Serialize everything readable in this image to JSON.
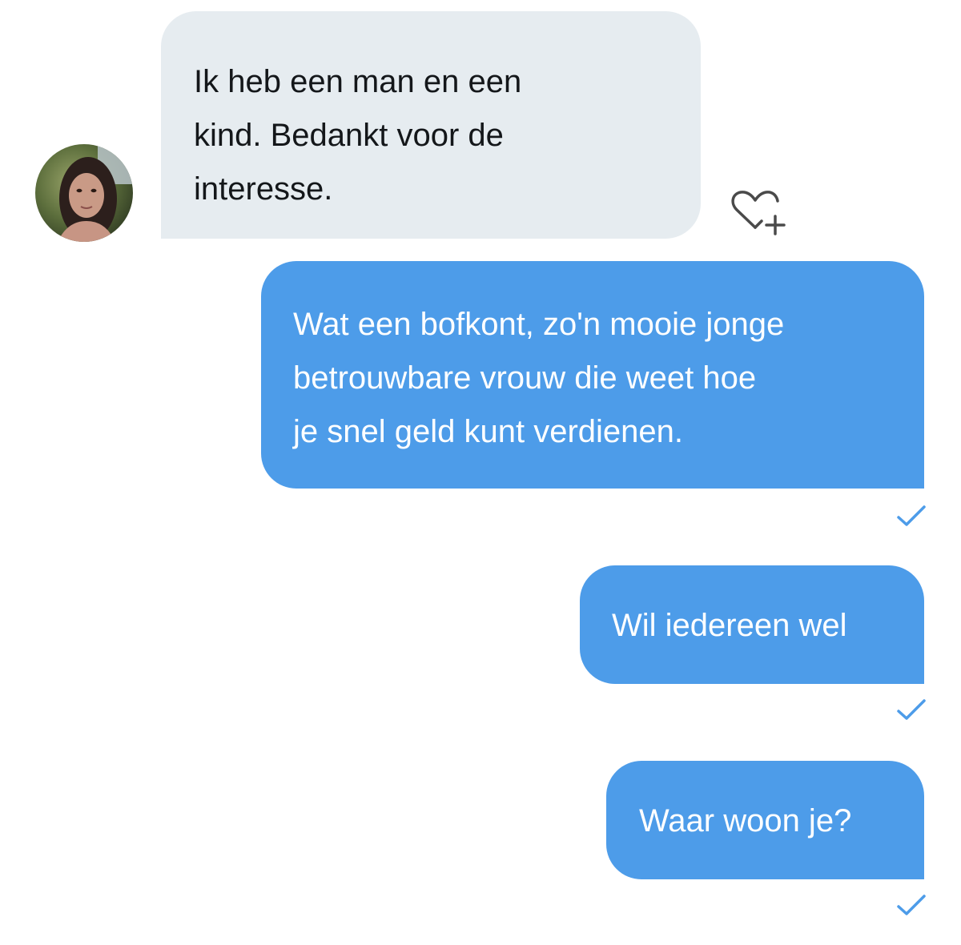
{
  "conversation": {
    "messages": [
      {
        "direction": "received",
        "text": "Ik heb een man en een\nkind. Bedankt voor de\ninteresse."
      },
      {
        "direction": "sent",
        "text": "Wat een bofkont, zo'n mooie jonge\nbetrouwbare vrouw die weet hoe\nje snel geld kunt verdienen."
      },
      {
        "direction": "sent",
        "text": "Wil iedereen wel"
      },
      {
        "direction": "sent",
        "text": "Waar woon je?"
      }
    ]
  },
  "icons": {
    "like": "heart-plus-icon",
    "read_receipt": "checkmark-icon"
  },
  "colors": {
    "received_bubble": "#e6ecf0",
    "received_text": "#14171a",
    "sent_bubble": "#4d9ce9",
    "sent_text": "#ffffff",
    "checkmark": "#4d9ce9",
    "icon_stroke": "#4a4a4a"
  }
}
